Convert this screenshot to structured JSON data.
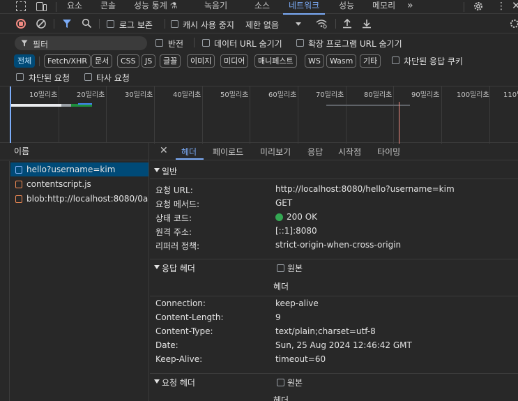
{
  "tabs": [
    {
      "label": "요소"
    },
    {
      "label": "콘솔"
    },
    {
      "label": "성능 통계 ⚗"
    },
    {
      "label": "녹음기"
    },
    {
      "label": "소스"
    },
    {
      "label": "네트워크",
      "active": true
    },
    {
      "label": "성능"
    },
    {
      "label": "메모리"
    },
    {
      "label": "»"
    }
  ],
  "toolbar": {
    "preserve_log": "로그 보존",
    "disable_cache": "캐시 사용 중지",
    "throttling": "제한 없음"
  },
  "filter": {
    "placeholder": "필터",
    "invert": "반전",
    "hide_data_urls": "데이터 URL 숨기기",
    "hide_extension_urls": "확장 프로그램 URL 숨기기"
  },
  "type_chips": [
    "전체",
    "Fetch/XHR",
    "문서",
    "CSS",
    "JS",
    "글꼴",
    "이미지",
    "미디어",
    "매니페스트",
    "WS",
    "Wasm",
    "기타"
  ],
  "blocked_cookies": "차단된 응답 쿠키",
  "blocked_requests": "차단된 요청",
  "third_party": "타사 요청",
  "timeline_ticks": [
    "10밀리초",
    "20밀리초",
    "30밀리초",
    "40밀리초",
    "50밀리초",
    "60밀리초",
    "70밀리초",
    "80밀리초",
    "90밀리초",
    "100밀리초",
    "110밀"
  ],
  "requests": {
    "header": "이름",
    "items": [
      {
        "name": "hello?username=kim",
        "selected": true
      },
      {
        "name": "contentscript.js"
      },
      {
        "name": "blob:http://localhost:8080/0a..."
      }
    ]
  },
  "detail_tabs": [
    "헤더",
    "페이로드",
    "미리보기",
    "응답",
    "시작점",
    "타이밍"
  ],
  "general": {
    "title": "일반",
    "rows": [
      {
        "k": "요청 URL:",
        "v": "http://localhost:8080/hello?username=kim"
      },
      {
        "k": "요청 메서드:",
        "v": "GET"
      },
      {
        "k": "상태 코드:",
        "v": "200 OK"
      },
      {
        "k": "원격 주소:",
        "v": "[::1]:8080"
      },
      {
        "k": "리퍼러 정책:",
        "v": "strict-origin-when-cross-origin"
      }
    ]
  },
  "response_headers": {
    "title": "응답 헤더",
    "raw": "원본",
    "sub": "헤더",
    "rows": [
      {
        "k": "Connection:",
        "v": "keep-alive"
      },
      {
        "k": "Content-Length:",
        "v": "9"
      },
      {
        "k": "Content-Type:",
        "v": "text/plain;charset=utf-8"
      },
      {
        "k": "Date:",
        "v": "Sun, 25 Aug 2024 12:46:42 GMT"
      },
      {
        "k": "Keep-Alive:",
        "v": "timeout=60"
      }
    ]
  },
  "request_headers": {
    "title": "요청 헤더",
    "raw": "원본",
    "sub": "헤더"
  },
  "colors": {
    "accent": "#7cacf8",
    "selected_bg": "#004a77",
    "status_ok": "#34a853",
    "js_icon": "#f28b54"
  }
}
